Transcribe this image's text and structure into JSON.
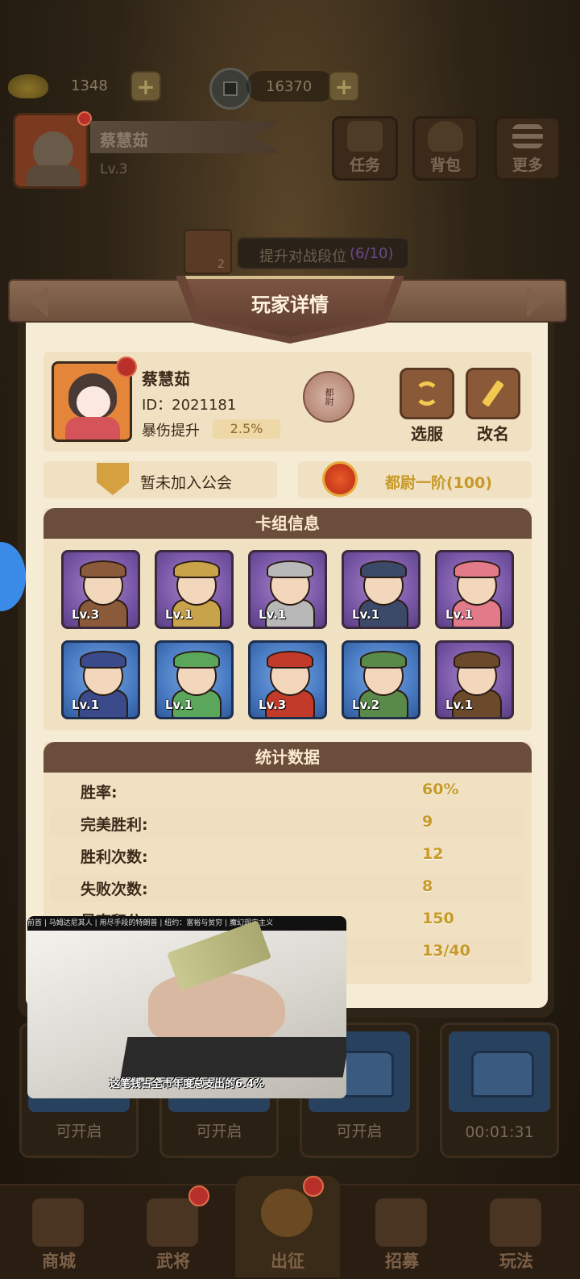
{
  "top_bar": {
    "ingots": "1348",
    "coins": "16370",
    "plus_glyph": "+"
  },
  "player_header": {
    "name": "蔡慧茹",
    "level": "Lv.3"
  },
  "top_buttons": [
    {
      "label": "任务",
      "icon": "scroll-icon"
    },
    {
      "label": "背包",
      "icon": "bag-icon"
    },
    {
      "label": "更多",
      "icon": "menu-icon"
    }
  ],
  "rank_banner": {
    "text": "提升对战段位",
    "progress": "(6/10)",
    "badge_count": "2"
  },
  "modal": {
    "title": "玩家详情",
    "player": {
      "name": "蔡慧茹",
      "id": "ID：2021181",
      "bonus_label": "暴伤提升",
      "bonus_value": "2.5%",
      "rank_seal": "都尉"
    },
    "actions": {
      "select_server": "选服",
      "rename": "改名"
    },
    "guild": "暂未加入公会",
    "rank": "都尉一阶(100)",
    "deck_title": "卡组信息",
    "heroes": [
      {
        "level": "Lv.3",
        "frame": "purple",
        "color": "#8a5a3a"
      },
      {
        "level": "Lv.1",
        "frame": "purple",
        "color": "#c9a34a"
      },
      {
        "level": "Lv.1",
        "frame": "purple",
        "color": "#b8b8b8"
      },
      {
        "level": "Lv.1",
        "frame": "purple",
        "color": "#3c4a6a"
      },
      {
        "level": "Lv.1",
        "frame": "purple",
        "color": "#e27a8a"
      },
      {
        "level": "Lv.1",
        "frame": "blue",
        "color": "#3a4a8a"
      },
      {
        "level": "Lv.1",
        "frame": "blue",
        "color": "#5aa65a"
      },
      {
        "level": "Lv.3",
        "frame": "blue",
        "color": "#c23a2a"
      },
      {
        "level": "Lv.2",
        "frame": "blue",
        "color": "#5a8a4a"
      },
      {
        "level": "Lv.1",
        "frame": "purple",
        "color": "#6a4a2a"
      }
    ],
    "stats_title": "统计数据",
    "stats": [
      {
        "label": "胜率:",
        "value": "60%"
      },
      {
        "label": "完美胜利:",
        "value": "9"
      },
      {
        "label": "胜利次数:",
        "value": "12"
      },
      {
        "label": "失败次数:",
        "value": "8"
      },
      {
        "label": "最高积分:",
        "value": "150"
      },
      {
        "label": "",
        "value": "13/40"
      }
    ]
  },
  "chests": [
    {
      "label": "可开启"
    },
    {
      "label": "可开启"
    },
    {
      "label": "可开启"
    },
    {
      "label": "00:01:31"
    }
  ],
  "bottom_nav": [
    {
      "label": "商城",
      "icon": "shop-icon"
    },
    {
      "label": "武将",
      "icon": "general-icon"
    },
    {
      "label": "出征",
      "icon": "battle-icon"
    },
    {
      "label": "招募",
      "icon": "recruit-icon"
    },
    {
      "label": "玩法",
      "icon": "temple-icon"
    }
  ],
  "video_ad": {
    "top_ticker": "前首  |  马姆达尼其人  |  用尽手段的特朗普  |  纽约：富裕与贫穷  |  魔幻现实主义",
    "caption": "这笔钱占全市年度总支出的6.4%"
  }
}
